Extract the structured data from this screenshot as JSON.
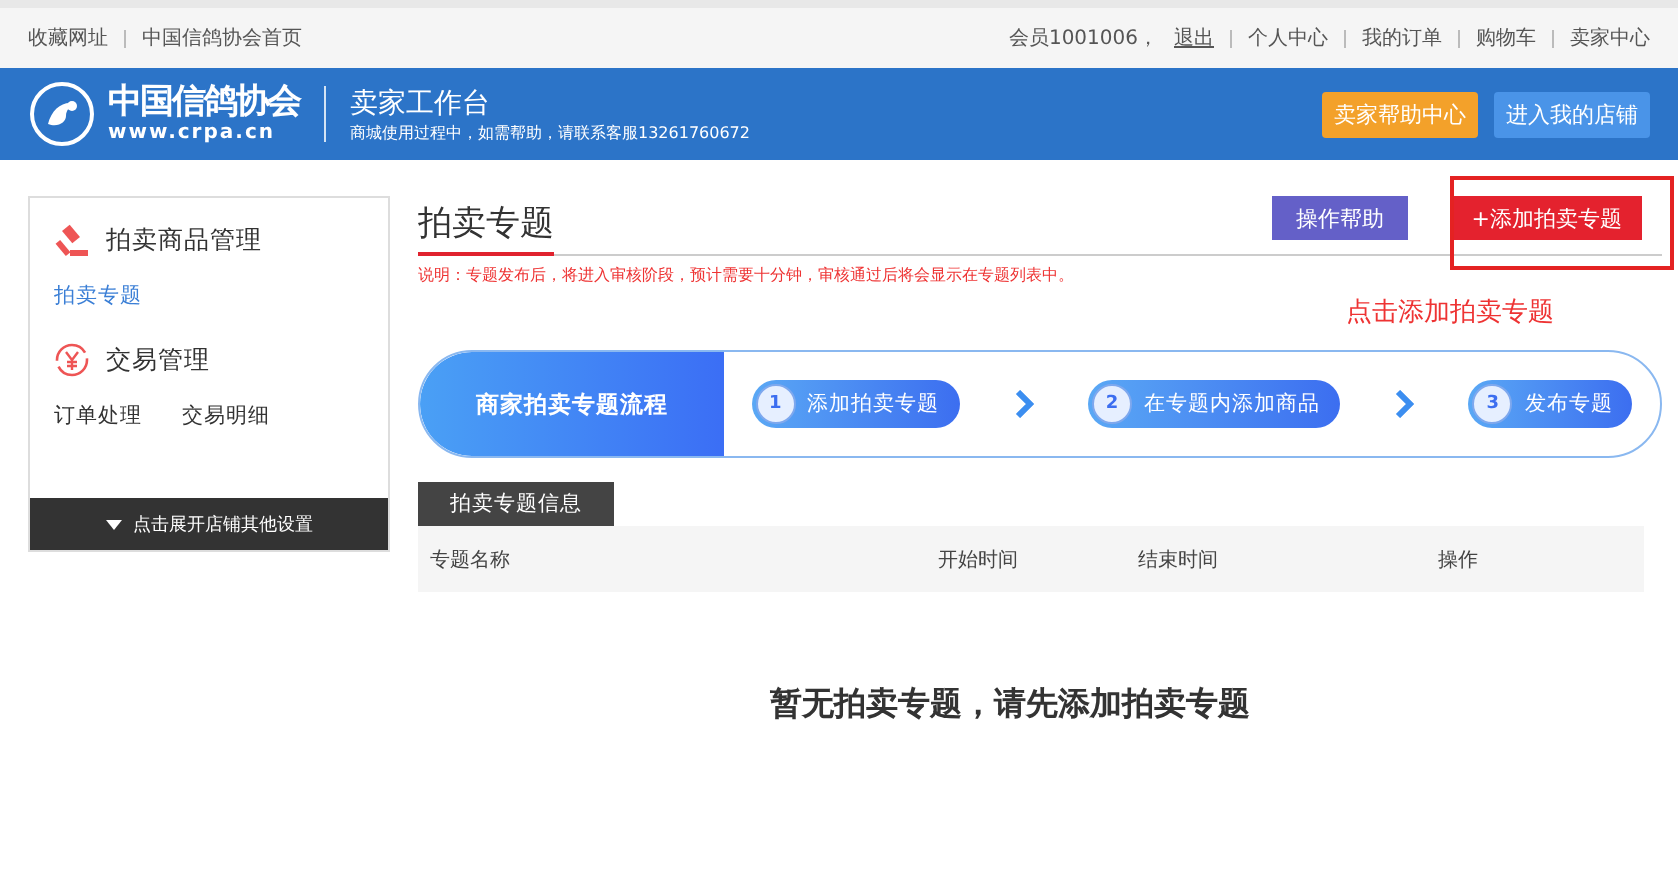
{
  "top_bar": {
    "left_links": [
      "收藏网址",
      "中国信鸽协会首页"
    ],
    "member": "会员1001006，",
    "logout": "退出",
    "right_links": [
      "个人中心",
      "我的订单",
      "购物车",
      "卖家中心"
    ]
  },
  "header": {
    "logo_name": "中国信鸽协会",
    "logo_url": "www.crpa.cn",
    "title": "卖家工作台",
    "subtitle": "商城使用过程中，如需帮助，请联系客服13261760672",
    "buttons": [
      {
        "label": "卖家帮助中心",
        "kind": "orange"
      },
      {
        "label": "进入我的店铺",
        "kind": "blue"
      }
    ]
  },
  "sidebar": {
    "sections": [
      {
        "title": "拍卖商品管理",
        "kind": "gavel",
        "links": [
          {
            "label": "拍卖专题",
            "selected": true
          }
        ]
      },
      {
        "title": "交易管理",
        "kind": "yen",
        "links": [
          {
            "label": "订单处理",
            "selected": false
          },
          {
            "label": "交易明细",
            "selected": false
          }
        ]
      }
    ],
    "expand": "点击展开店铺其他设置"
  },
  "main": {
    "title": "拍卖专题",
    "help_button": "操作帮助",
    "add_button": "+添加拍卖专题",
    "note": "说明：专题发布后，将进入审核阶段，预计需要十分钟，审核通过后将会显示在专题列表中。",
    "annotation": "点击添加拍卖专题",
    "flow": {
      "title": "商家拍卖专题流程",
      "steps": [
        {
          "number": "1",
          "label": "添加拍卖专题"
        },
        {
          "number": "2",
          "label": "在专题内添加商品"
        },
        {
          "number": "3",
          "label": "发布专题"
        }
      ]
    },
    "section_tab": "拍卖专题信息",
    "table": {
      "columns": [
        "专题名称",
        "开始时间",
        "结束时间",
        "操作"
      ]
    },
    "empty": "暂无拍卖专题，请先添加拍卖专题"
  }
}
